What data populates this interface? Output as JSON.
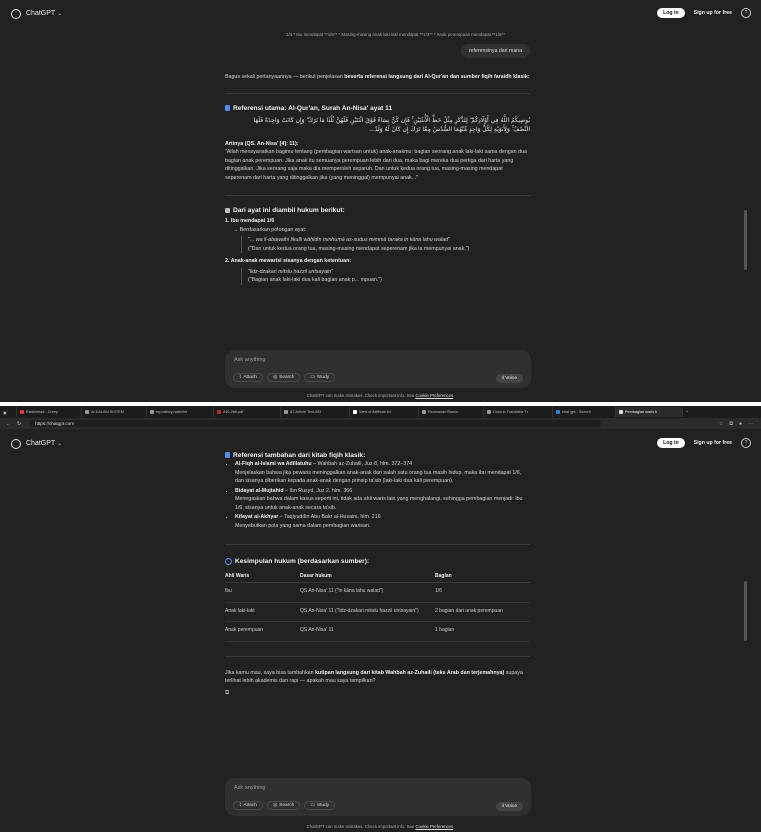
{
  "app": {
    "name": "ChatGPT",
    "login": "Log in",
    "signup": "Sign up for free",
    "help": "?"
  },
  "top": {
    "prior_message": "1/4 * Ibu mendapat **1/6** * Masing-masing anak laki-laki mendapat **1/3** * Anak perempuan mendapat **1/6**",
    "user_message": "referensinya dari mana",
    "intro_plain": "Bagus sekali pertanyaannya — berikut penjelasan ",
    "intro_bold": "beserta referensi langsung dari Al-Qur'an dan sumber fiqih faraidh klasik:",
    "ref_heading": "Referensi utama: Al-Qur'an, Surah An-Nisa' ayat 11",
    "arabic_1": "يُوصِيكُمُ اللَّهُ فِي أَوْلَادِكُمْ ۖ لِلذَّكَرِ مِثْلُ حَظِّ الْأُنثَيَيْنِ ۚ فَإِن كُنَّ نِسَاءً فَوْقَ اثْنَتَيْنِ فَلَهُنَّ ثُلُثَا مَا تَرَكَ ۖ وَإِن كَانَتْ وَاحِدَةً فَلَهَا",
    "arabic_2": "النِّصْفُ ۚ وَلِأَبَوَيْهِ لِكُلِّ وَاحِدٍ مِّنْهُمَا السُّدُسُ مِمَّا تَرَكَ إِن كَانَ لَهُ وَلَدٌ...",
    "translation_title": "Artinya (QS. An-Nisa' [4]: 11):",
    "translation_text": "\"Allah mensyariatkan bagimu tentang (pembagian warisan untuk) anak-anakmu: bagian seorang anak laki-laki sama dengan dua bagian anak perempuan. Jika anak itu semuanya perempuan lebih dari dua, maka bagi mereka dua pertiga dari harta yang ditinggalkan. Jika seorang saja maka dia memperoleh separuh. Dan untuk kedua orang tua, masing-masing mendapat seperenam dari harta yang ditinggalkan jika (yang meninggal) mempunyai anak...\"",
    "derived_heading": "Dari ayat ini diambil hukum berikut:",
    "item1_title": "1. Ibu mendapat 1/6",
    "item1_arrow": "→ Berdasarkan potongan ayat:",
    "item1_quote_italic": "\"... wa li-abawaihi likulli wāḥidin minhumā as-sudus mimmā taraka in kāna lahu walad\"",
    "item1_quote_trans": "(\"Dan untuk kedua orang tua, masing-masing mendapat seperenam jika ia mempunyai anak.\")",
    "item2_title": "2. Anak-anak mewarisi sisanya dengan ketentuan:",
    "item2_quote_italic": "\"lidz-dzakari mitslu ḥazzil untsayain\"",
    "item2_quote_trans": "(\"Bagian anak laki-laki dua kali bagian anak p... mpuan.\")",
    "composer_placeholder": "Ask anything",
    "tool_attach": "Attach",
    "tool_search": "Search",
    "tool_study": "Study",
    "tool_voice": "Voice",
    "footnote_plain": "ChatGPT can make mistakes. Check important info. See ",
    "footnote_link": "Cookie Preferences",
    "footnote_end": "."
  },
  "browser": {
    "tabs": [
      "Radiohead - Creep",
      "AI DALAM SISTEM",
      "repository.radenint",
      "240-266.pdf",
      "87-Article Text-981",
      "View of Artificial Int",
      "Keamanan Banke",
      "Draw.io Translator Tr",
      "chat gpt - Search",
      "Pembagian waris h"
    ],
    "url": "https://chatgpt.com"
  },
  "bottom": {
    "refs_heading": "Referensi tambahan dari kitab fiqih klasik:",
    "refs": [
      {
        "title": "Al-Fiqh al-Islami wa Adillatuhu",
        "author": " – Wahbah az-Zuhaili, Juz 8, hlm. 372–374",
        "desc": "Menjelaskan bahwa jika pewaris meninggalkan anak-anak dan salah satu orang tua masih hidup, maka ibu mendapat 1/6, dan sisanya diberikan kepada anak-anak dengan prinsip ta'sib (laki-laki dua kali perempuan)."
      },
      {
        "title": "Bidayat al-Mujtahid",
        "author": " – Ibn Rusyd, Juz 2, hlm. 366",
        "desc": "Menegaskan bahwa dalam kasus seperti ini, tidak ada ahli waris lain yang menghalangi, sehingga pembagian menjadi: ibu 1/6, sisanya untuk anak-anak secara ta'sib."
      },
      {
        "title": "Kifayat al-Akhyar",
        "author": " – Taqiyuddin Abu Bakr al-Husaini, hlm. 216",
        "desc": "Menyebutkan pola yang sama dalam pembagian warisan."
      }
    ],
    "summary_heading": "Kesimpulan hukum (berdasarkan sumber):",
    "table_headers": [
      "Ahli Waris",
      "Dasar hukum",
      "Bagian"
    ],
    "table_rows": [
      [
        "Ibu",
        "QS An-Nisa' 11 (\"in kāna lahu walad\")",
        "1/6"
      ],
      [
        "Anak laki-laki",
        "QS An-Nisa' 11 (\"lidz-dzakari mitslu ḥazzil untsayain\")",
        "2 bagian dari anak perempuan"
      ],
      [
        "Anak perempuan",
        "QS An-Nisa' 11",
        "1 bagian"
      ]
    ],
    "closing_plain1": "Jika kamu mau, saya bisa tambahkan ",
    "closing_bold": "kutipan langsung dari kitab Wahbah az-Zuhaili (teks Arab dan terjemahnya)",
    "closing_plain2": " supaya terlihat lebih akademis dan rapi — apakah mau saya tampilkan?"
  },
  "colors": {
    "background": "#212121",
    "composer": "#303030",
    "accent_blue": "#4a8ff0"
  }
}
